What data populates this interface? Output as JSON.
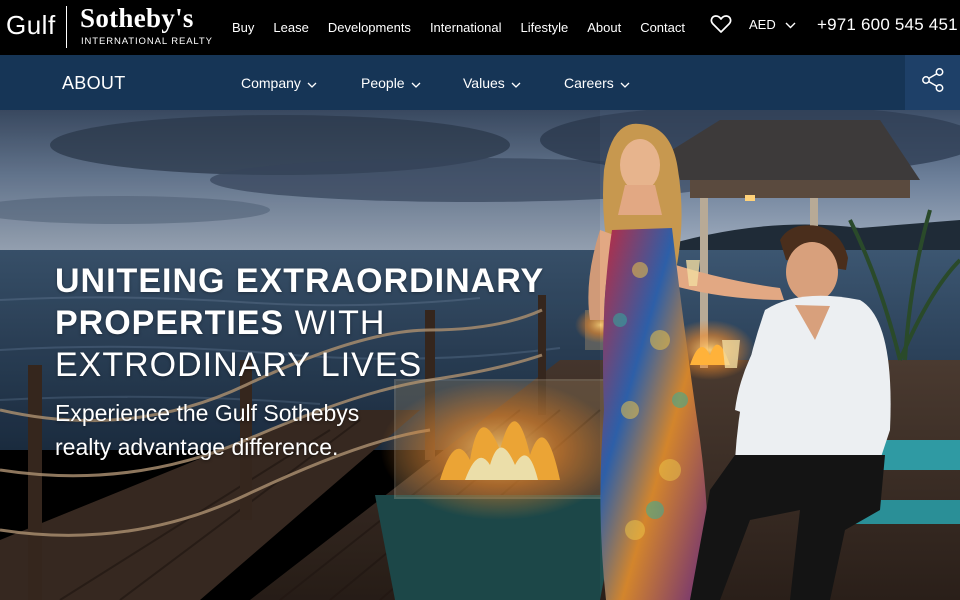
{
  "brand": {
    "gulf": "Gulf",
    "sothebys": "Sotheby's",
    "subtitle": "INTERNATIONAL REALTY"
  },
  "main_nav": {
    "items": [
      {
        "label": "Buy"
      },
      {
        "label": "Lease"
      },
      {
        "label": "Developments"
      },
      {
        "label": "International"
      },
      {
        "label": "Lifestyle"
      },
      {
        "label": "About"
      },
      {
        "label": "Contact"
      }
    ]
  },
  "header": {
    "favorites_icon": "heart-icon",
    "currency": "AED",
    "phone": "+971 600 545 451"
  },
  "sub_nav": {
    "title": "ABOUT",
    "items": [
      {
        "label": "Company"
      },
      {
        "label": "People"
      },
      {
        "label": "Values"
      },
      {
        "label": "Careers"
      }
    ],
    "share_icon": "share-icon"
  },
  "hero": {
    "headline": {
      "line1": "UNITEING EXTRAORDINARY",
      "line2_bold": "PROPERTIES",
      "line2_thin": " WITH",
      "line3": "EXTRODINARY LIVES"
    },
    "tagline": {
      "line1": "Experience the Gulf Sothebys",
      "line2": "realty advantage difference."
    }
  },
  "colors": {
    "topbar_bg": "#000000",
    "subnav_bg": "#163556",
    "share_bg": "#1e4068",
    "text": "#ffffff"
  }
}
